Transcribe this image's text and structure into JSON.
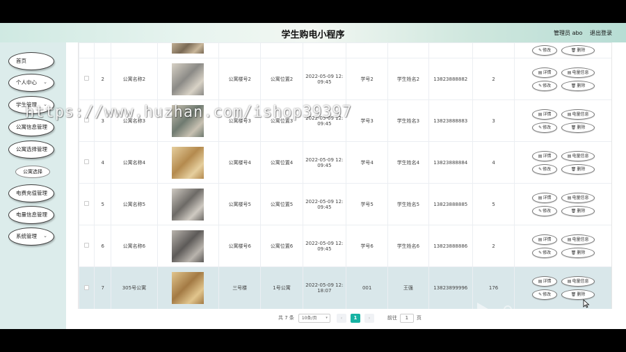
{
  "header": {
    "title": "学生购电小程序",
    "user": "管理员 abo",
    "logout": "退出登录"
  },
  "sidebar": {
    "items": [
      {
        "label": "首页",
        "chevron": false
      },
      {
        "label": "个人中心",
        "chevron": true
      },
      {
        "label": "学生管理",
        "chevron": true
      },
      {
        "label": "公寓信息管理",
        "chevron": false
      },
      {
        "label": "公寓选择管理",
        "chevron": false
      },
      {
        "label": "电费充值管理",
        "chevron": false
      },
      {
        "label": "电量信息管理",
        "chevron": false
      },
      {
        "label": "系统管理",
        "chevron": true
      }
    ],
    "sub_item": "公寓选择"
  },
  "table": {
    "rows": [
      {
        "id": "",
        "name": "",
        "building": "",
        "location": "",
        "time1": "",
        "time2": "",
        "stu_no": "",
        "stu_name": "",
        "phone": "",
        "count": ""
      },
      {
        "id": "2",
        "name": "公寓名称2",
        "building": "公寓楼号2",
        "location": "公寓位置2",
        "time1": "2022-05-09 12:",
        "time2": "09:45",
        "stu_no": "学号2",
        "stu_name": "学生姓名2",
        "phone": "13823888882",
        "count": "2"
      },
      {
        "id": "3",
        "name": "公寓名称3",
        "building": "公寓楼号3",
        "location": "公寓位置3",
        "time1": "2022-05-09 12:",
        "time2": "09:45",
        "stu_no": "学号3",
        "stu_name": "学生姓名3",
        "phone": "13823888883",
        "count": "3"
      },
      {
        "id": "4",
        "name": "公寓名称4",
        "building": "公寓楼号4",
        "location": "公寓位置4",
        "time1": "2022-05-09 12:",
        "time2": "09:45",
        "stu_no": "学号4",
        "stu_name": "学生姓名4",
        "phone": "13823888884",
        "count": "4"
      },
      {
        "id": "5",
        "name": "公寓名称5",
        "building": "公寓楼号5",
        "location": "公寓位置5",
        "time1": "2022-05-09 12:",
        "time2": "09:45",
        "stu_no": "学号5",
        "stu_name": "学生姓名5",
        "phone": "13823888885",
        "count": "5"
      },
      {
        "id": "6",
        "name": "公寓名称6",
        "building": "公寓楼号6",
        "location": "公寓位置6",
        "time1": "2022-05-09 12:",
        "time2": "09:45",
        "stu_no": "学号6",
        "stu_name": "学生姓名6",
        "phone": "13823888886",
        "count": "2"
      },
      {
        "id": "7",
        "name": "305号公寓",
        "building": "三号楼",
        "location": "1号公寓",
        "time1": "2022-05-09 12:",
        "time2": "18:07",
        "stu_no": "001",
        "stu_name": "王强",
        "phone": "13823899996",
        "count": "176"
      }
    ],
    "actions": {
      "detail": "详情",
      "power": "电量信息",
      "edit": "修改",
      "delete": "删除"
    },
    "selected_row": 7
  },
  "pagination": {
    "total": "共 7 条",
    "page_size": "10条/页",
    "prev": "‹",
    "current": "1",
    "next": "›",
    "goto_label": "前往",
    "goto_value": "1",
    "page_unit": "页"
  },
  "watermark": "https://www.huzhan.com/ishop39397",
  "colors": {
    "accent": "#17b3a3",
    "sidebar_bg": "#dceceb",
    "selected_row": "#d9e7ea"
  },
  "icons": {
    "detail": "document-icon",
    "power": "document-icon",
    "edit": "pencil-icon",
    "delete": "trash-icon"
  }
}
